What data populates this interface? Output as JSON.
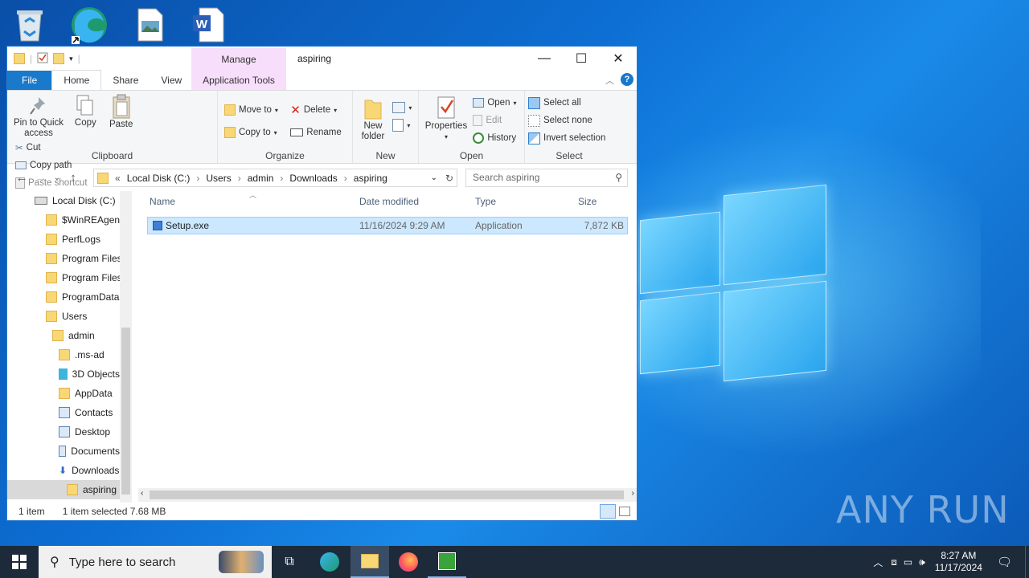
{
  "window": {
    "title": "aspiring",
    "manage_label": "Manage",
    "tabs": [
      "File",
      "Home",
      "Share",
      "View",
      "Application Tools"
    ]
  },
  "ribbon": {
    "clipboard": {
      "label": "Clipboard",
      "pin": "Pin to Quick access",
      "copy": "Copy",
      "paste": "Paste",
      "cut": "Cut",
      "copy_path": "Copy path",
      "paste_shortcut": "Paste shortcut"
    },
    "organize": {
      "label": "Organize",
      "move_to": "Move to",
      "copy_to": "Copy to",
      "delete": "Delete",
      "rename": "Rename"
    },
    "new": {
      "label": "New",
      "new_folder": "New folder"
    },
    "open": {
      "label": "Open",
      "properties": "Properties",
      "open": "Open",
      "edit": "Edit",
      "history": "History"
    },
    "select": {
      "label": "Select",
      "select_all": "Select all",
      "select_none": "Select none",
      "invert": "Invert selection"
    }
  },
  "address": {
    "prefix": "«",
    "crumbs": [
      "Local Disk (C:)",
      "Users",
      "admin",
      "Downloads",
      "aspiring"
    ],
    "search_placeholder": "Search aspiring"
  },
  "nav": {
    "items": [
      {
        "label": "Local Disk (C:)",
        "indent": 0,
        "icon": "drive-icon"
      },
      {
        "label": "$WinREAgent",
        "indent": 1,
        "icon": "folder-icon"
      },
      {
        "label": "PerfLogs",
        "indent": 1,
        "icon": "folder-icon"
      },
      {
        "label": "Program Files",
        "indent": 1,
        "icon": "folder-icon"
      },
      {
        "label": "Program Files",
        "indent": 1,
        "icon": "folder-icon"
      },
      {
        "label": "ProgramData",
        "indent": 1,
        "icon": "folder-icon"
      },
      {
        "label": "Users",
        "indent": 1,
        "icon": "folder-icon"
      },
      {
        "label": "admin",
        "indent": 2,
        "icon": "folder-icon"
      },
      {
        "label": ".ms-ad",
        "indent": 3,
        "icon": "folder-icon"
      },
      {
        "label": "3D Objects",
        "indent": 3,
        "icon": "cube-icon"
      },
      {
        "label": "AppData",
        "indent": 3,
        "icon": "folder-icon"
      },
      {
        "label": "Contacts",
        "indent": 3,
        "icon": "contacts-icon"
      },
      {
        "label": "Desktop",
        "indent": 3,
        "icon": "desktop-icon"
      },
      {
        "label": "Documents",
        "indent": 3,
        "icon": "documents-icon"
      },
      {
        "label": "Downloads",
        "indent": 3,
        "icon": "download-icon"
      },
      {
        "label": "aspiring",
        "indent": 4,
        "icon": "folder-icon"
      }
    ]
  },
  "columns": {
    "name": "Name",
    "date": "Date modified",
    "type": "Type",
    "size": "Size"
  },
  "files": [
    {
      "name": "Setup.exe",
      "date": "11/16/2024 9:29 AM",
      "type": "Application",
      "size": "7,872 KB"
    }
  ],
  "status": {
    "count": "1 item",
    "selected": "1 item selected  7.68 MB"
  },
  "taskbar": {
    "search_placeholder": "Type here to search",
    "time": "8:27 AM",
    "date": "11/17/2024"
  },
  "watermark": "ANY RUN",
  "colors": {
    "accent": "#1979ca",
    "selection": "#cce8ff",
    "manage_tab": "#f7defa",
    "taskbar": "#1c2a3a"
  }
}
